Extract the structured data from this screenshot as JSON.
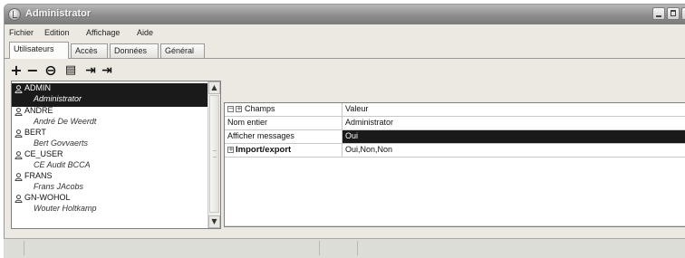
{
  "window": {
    "title": "Administrator"
  },
  "menu": {
    "items": [
      "Fichier",
      "Edition",
      "Affichage",
      "Aide"
    ]
  },
  "tabs": [
    {
      "label": "Utilisateurs",
      "active": true
    },
    {
      "label": "Accès",
      "active": false
    },
    {
      "label": "Données",
      "active": false
    },
    {
      "label": "Général",
      "active": false
    }
  ],
  "toolbar": {
    "buttons": [
      {
        "icon": "add-icon",
        "glyph": "+"
      },
      {
        "icon": "remove-icon",
        "glyph": "−"
      },
      {
        "icon": "block-icon",
        "glyph": "⊖"
      },
      {
        "icon": "properties-icon",
        "glyph": "▤"
      },
      {
        "icon": "export-icon",
        "glyph": "⇥"
      },
      {
        "icon": "import-icon",
        "glyph": "⇥"
      }
    ]
  },
  "users": [
    {
      "id": "ADMIN",
      "name": "Administrator",
      "selected": true
    },
    {
      "id": "ANDRE",
      "name": "André De Weerdt",
      "selected": false
    },
    {
      "id": "BERT",
      "name": "Bert Govvaerts",
      "selected": false
    },
    {
      "id": "CE_USER",
      "name": "CE Audit BCCA",
      "selected": false
    },
    {
      "id": "FRANS",
      "name": "Frans JAcobs",
      "selected": false
    },
    {
      "id": "GN-WOHOL",
      "name": "Wouter Holtkamp",
      "selected": false
    }
  ],
  "properties": {
    "headers": {
      "field": "Champs",
      "value": "Valeur"
    },
    "rows": [
      {
        "field": "Nom entier",
        "value": "Administrator",
        "selected": false,
        "bold": false,
        "expandable": false
      },
      {
        "field": "Afficher messages",
        "value": "Oui",
        "selected": true,
        "bold": false,
        "expandable": false
      },
      {
        "field": "Import/export",
        "value": "Oui,Non,Non",
        "selected": false,
        "bold": true,
        "expandable": true
      }
    ]
  },
  "colors": {
    "selection": "#1a1a1a",
    "window_bg": "#ece9e2",
    "titlebar": "#8e8e8e"
  }
}
